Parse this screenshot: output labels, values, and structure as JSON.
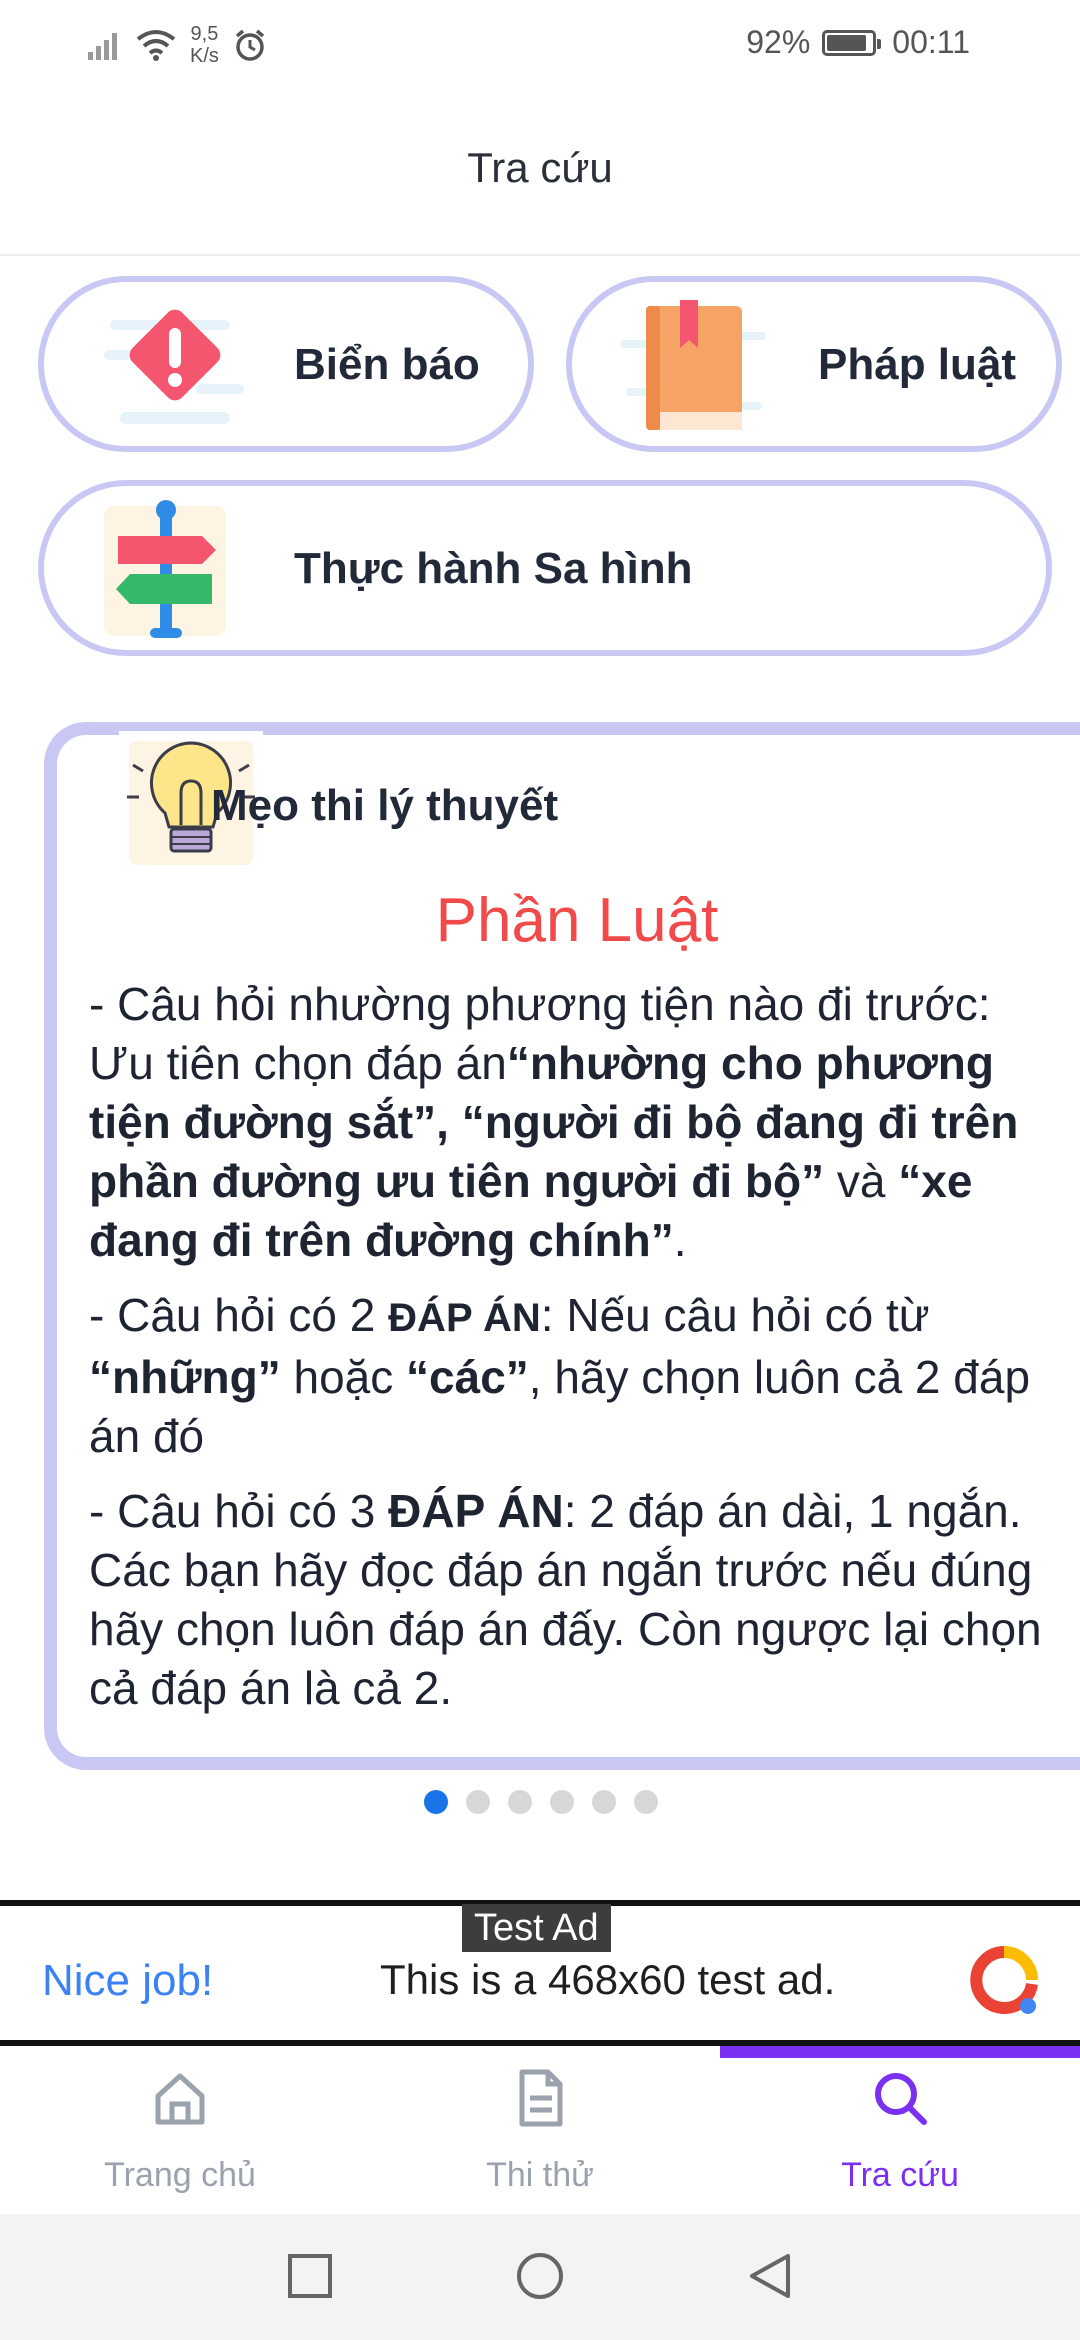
{
  "status_bar": {
    "speed_value": "9,5",
    "speed_unit": "K/s",
    "battery": "92%",
    "battery_level": 0.92,
    "time": "00:11"
  },
  "header": {
    "title": "Tra cứu"
  },
  "categories": [
    {
      "label": "Biển báo",
      "icon": "warning-sign-icon"
    },
    {
      "label": "Pháp luật",
      "icon": "law-book-icon"
    },
    {
      "label": "Thực hành Sa hình",
      "icon": "signpost-icon"
    }
  ],
  "tips": {
    "title": "Mẹo thi lý thuyết",
    "section": "Phần Luật",
    "p1_a": "- Câu hỏi nhường phương tiện nào đi trước: Ưu tiên chọn đáp án",
    "p1_b": "“nhường cho phương tiện đường sắt”, “người đi bộ đang đi trên phần đường ưu tiên người đi bộ”",
    "p1_c": " và ",
    "p1_d": "“xe đang đi trên đường chính”",
    "p1_e": ".",
    "p2_a": "- Câu hỏi có 2 ",
    "p2_b": "ĐÁP ÁN",
    "p2_c": ": Nếu câu hỏi có từ ",
    "p2_d": "“những”",
    "p2_e": " hoặc ",
    "p2_f": "“các”",
    "p2_g": ", hãy chọn luôn cả 2 đáp án đó",
    "p3_a": "- Câu hỏi có 3 ",
    "p3_b": "ĐÁP ÁN",
    "p3_c": ": 2 đáp án dài, 1 ngắn. Các bạn hãy đọc đáp án ngắn trước nếu đúng hãy chọn luôn đáp án đấy. Còn ngược lại chọn cả đáp án là cả 2."
  },
  "pager": {
    "count": 6,
    "active": 1
  },
  "ad": {
    "badge": "Test Ad",
    "headline": "Nice job!",
    "text": "This is a 468x60 test ad."
  },
  "bottom_nav": [
    {
      "label": "Trang chủ",
      "icon": "home-icon",
      "active": false
    },
    {
      "label": "Thi thử",
      "icon": "document-icon",
      "active": false
    },
    {
      "label": "Tra cứu",
      "icon": "search-icon",
      "active": true
    }
  ],
  "colors": {
    "accent": "#7b2ff0",
    "pill_border": "#c9c8f5",
    "section_red": "#f04a4a",
    "ad_blue": "#3b82f6"
  }
}
